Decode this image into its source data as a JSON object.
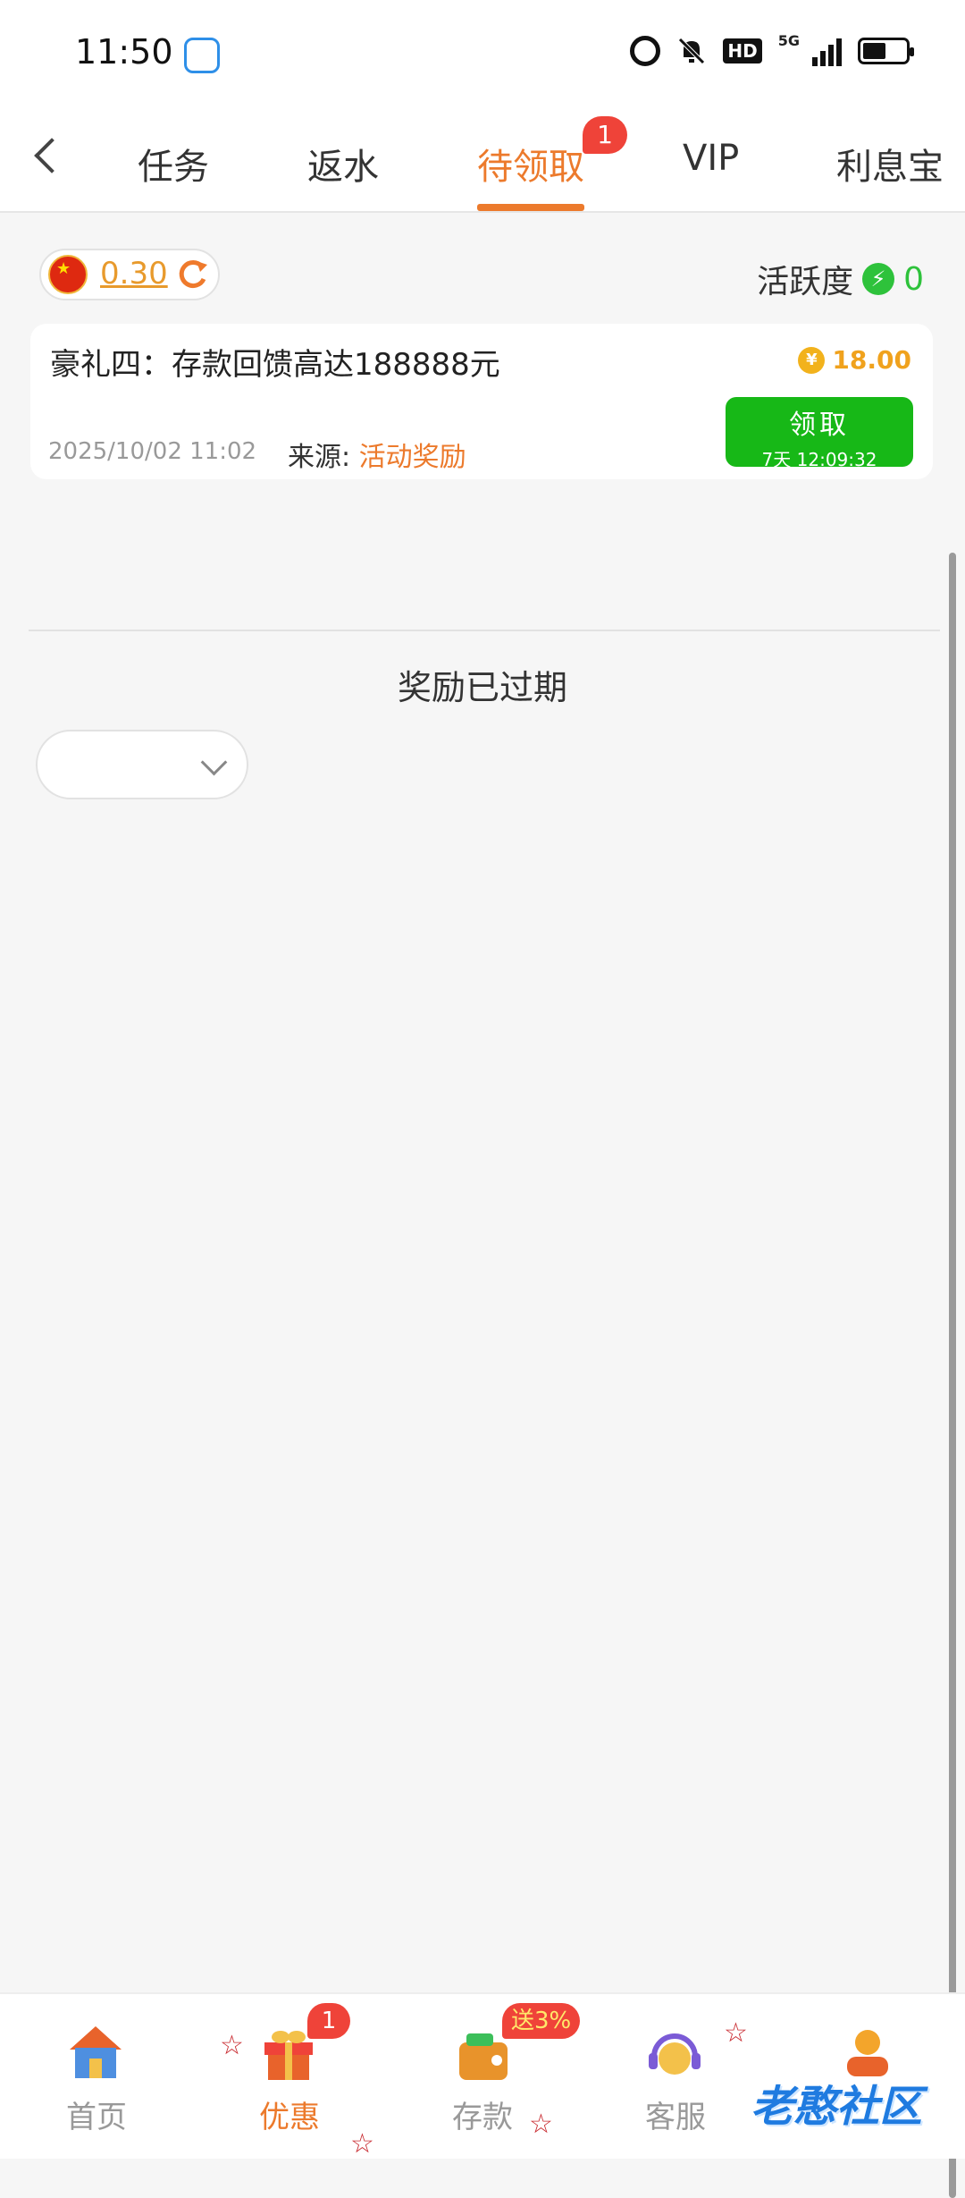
{
  "status_bar": {
    "time": "11:50",
    "network": "5G",
    "hd": "HD",
    "icons": [
      "app-icon",
      "alarm-icon",
      "mute-bell-icon",
      "hd-icon",
      "signal-icon",
      "battery-icon"
    ]
  },
  "tabs": [
    {
      "label": "任务"
    },
    {
      "label": "返水"
    },
    {
      "label": "待领取",
      "badge": "1",
      "active": true
    },
    {
      "label": "VIP"
    },
    {
      "label": "利息宝"
    }
  ],
  "balance": {
    "value": "0.30"
  },
  "activity": {
    "label": "活跃度",
    "value": "0"
  },
  "reward_card": {
    "title": "豪礼四：存款回馈高达188888元",
    "amount": "18.00",
    "currency_symbol": "¥",
    "date": "2025/10/02 11:02",
    "source_label": "来源:",
    "source_value": "活动奖励",
    "claim_label": "领取",
    "countdown": "7天 12:09:32"
  },
  "expired_section": {
    "title": "奖励已过期",
    "dropdown_value": ""
  },
  "bottom_nav": {
    "items": [
      {
        "label": "首页"
      },
      {
        "label": "优惠",
        "badge": "1",
        "active": true
      },
      {
        "label": "存款",
        "badge": "送3%"
      },
      {
        "label": "客服"
      }
    ],
    "watermark": "老憨社区"
  },
  "colors": {
    "accent": "#ec7a2c",
    "claim_button": "#17b817",
    "activity_green": "#2ec23b",
    "badge_red": "#ef4339",
    "coin_gold": "#f0a21d"
  }
}
